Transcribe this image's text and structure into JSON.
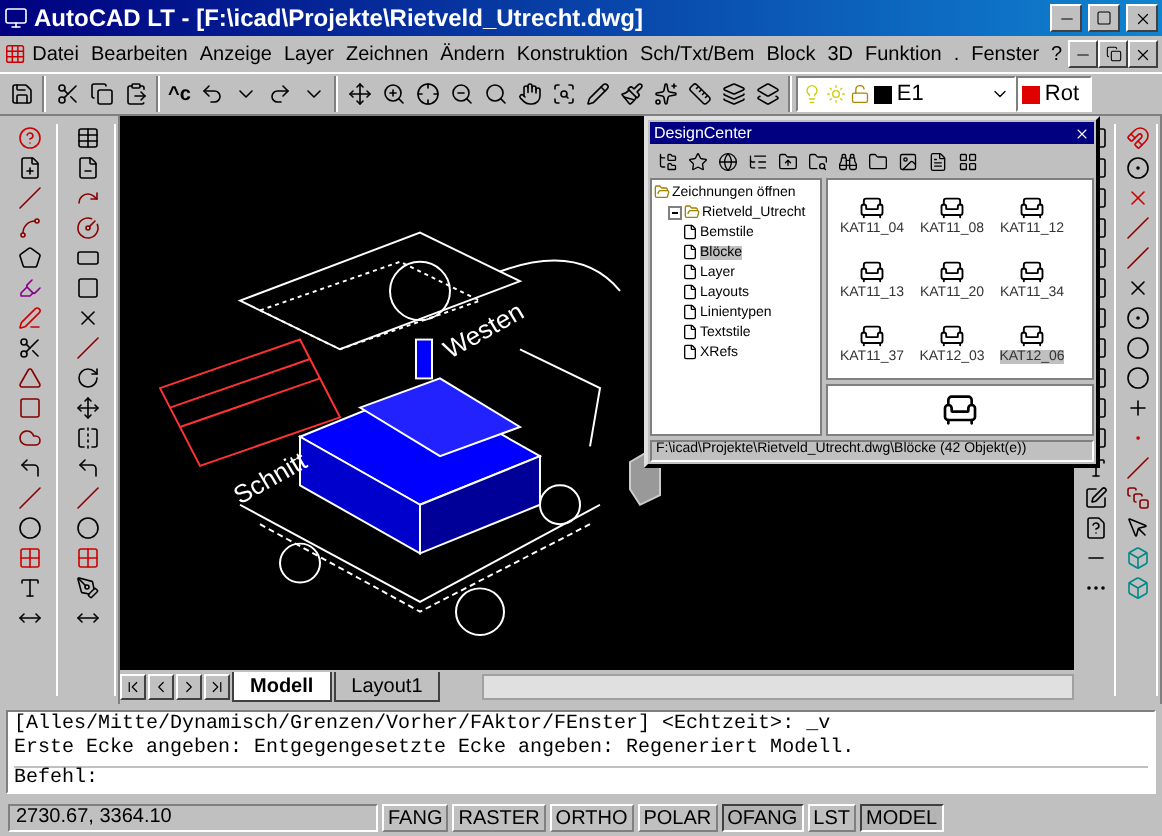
{
  "window": {
    "title": "AutoCAD LT - [F:\\icad\\Projekte\\Rietveld_Utrecht.dwg]"
  },
  "menu": [
    "Datei",
    "Bearbeiten",
    "Anzeige",
    "Layer",
    "Zeichnen",
    "Ändern",
    "Konstruktion",
    "Sch/Txt/Bem",
    "Block",
    "3D",
    "Funktion",
    ".",
    "Fenster",
    "?"
  ],
  "toolbar": {
    "copy_clip_label": "^c",
    "layer": "E1",
    "color_label": "Rot"
  },
  "drawing": {
    "labels": [
      "Schnitt",
      "Westen"
    ]
  },
  "designcenter": {
    "title": "DesignCenter",
    "tree": [
      {
        "label": "Zeichnungen öffnen",
        "selected": false,
        "expanded": true,
        "children": [
          {
            "label": "Rietveld_Utrecht",
            "selected": false,
            "expanded": true,
            "children": [
              {
                "label": "Bemstile",
                "selected": false
              },
              {
                "label": "Blöcke",
                "selected": true
              },
              {
                "label": "Layer",
                "selected": false
              },
              {
                "label": "Layouts",
                "selected": false
              },
              {
                "label": "Linientypen",
                "selected": false
              },
              {
                "label": "Textstile",
                "selected": false
              },
              {
                "label": "XRefs",
                "selected": false
              }
            ]
          }
        ]
      }
    ],
    "items": [
      {
        "label": "KAT11_04",
        "selected": false
      },
      {
        "label": "KAT11_08",
        "selected": false
      },
      {
        "label": "KAT11_12",
        "selected": false
      },
      {
        "label": "KAT11_13",
        "selected": false
      },
      {
        "label": "KAT11_20",
        "selected": false
      },
      {
        "label": "KAT11_34",
        "selected": false
      },
      {
        "label": "KAT11_37",
        "selected": false
      },
      {
        "label": "KAT12_03",
        "selected": false
      },
      {
        "label": "KAT12_06",
        "selected": true
      }
    ],
    "status": "F:\\icad\\Projekte\\Rietveld_Utrecht.dwg\\Blöcke (42 Objekt(e))"
  },
  "tabs": [
    {
      "label": "Modell",
      "selected": true
    },
    {
      "label": "Layout1",
      "selected": false
    }
  ],
  "command": {
    "history": [
      "[Alles/Mitte/Dynamisch/Grenzen/Vorher/FAktor/FEnster] <Echtzeit>: _v",
      "Erste Ecke angeben: Entgegengesetzte Ecke angeben: Regeneriert Modell."
    ],
    "prompt": "Befehl:"
  },
  "status_bar": {
    "coordinates": "2730.67, 3364.10",
    "toggles": [
      {
        "label": "FANG",
        "on": false
      },
      {
        "label": "RASTER",
        "on": false
      },
      {
        "label": "ORTHO",
        "on": false
      },
      {
        "label": "POLAR",
        "on": false
      },
      {
        "label": "OFANG",
        "on": true
      },
      {
        "label": "LST",
        "on": false
      },
      {
        "label": "MODEL",
        "on": true
      }
    ]
  }
}
